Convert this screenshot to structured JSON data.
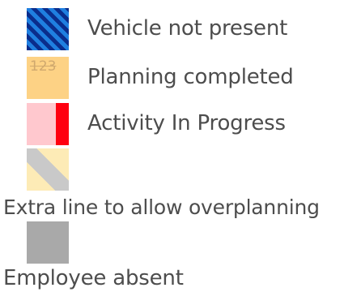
{
  "legend": {
    "items": [
      {
        "label": "Vehicle not present",
        "pattern": "blue-diagonal-stripes",
        "colors": [
          "#0a2d8c",
          "#1f7fe0"
        ]
      },
      {
        "label": "Planning completed",
        "pattern": "orange-struck-number",
        "number_text": "123",
        "colors": [
          "#fdd285",
          "#c9a36a"
        ]
      },
      {
        "label": "Activity In Progress",
        "pattern": "pink-red-bar",
        "colors": [
          "#ffc8ce",
          "#ff0010"
        ]
      },
      {
        "label": "Extra line to allow overplanning",
        "pattern": "yellow-grey-diagonal",
        "colors": [
          "#fdebb6",
          "#c9c9c9"
        ]
      },
      {
        "label": "Employee absent",
        "pattern": "solid-grey",
        "colors": [
          "#a9a9a9"
        ]
      }
    ]
  }
}
